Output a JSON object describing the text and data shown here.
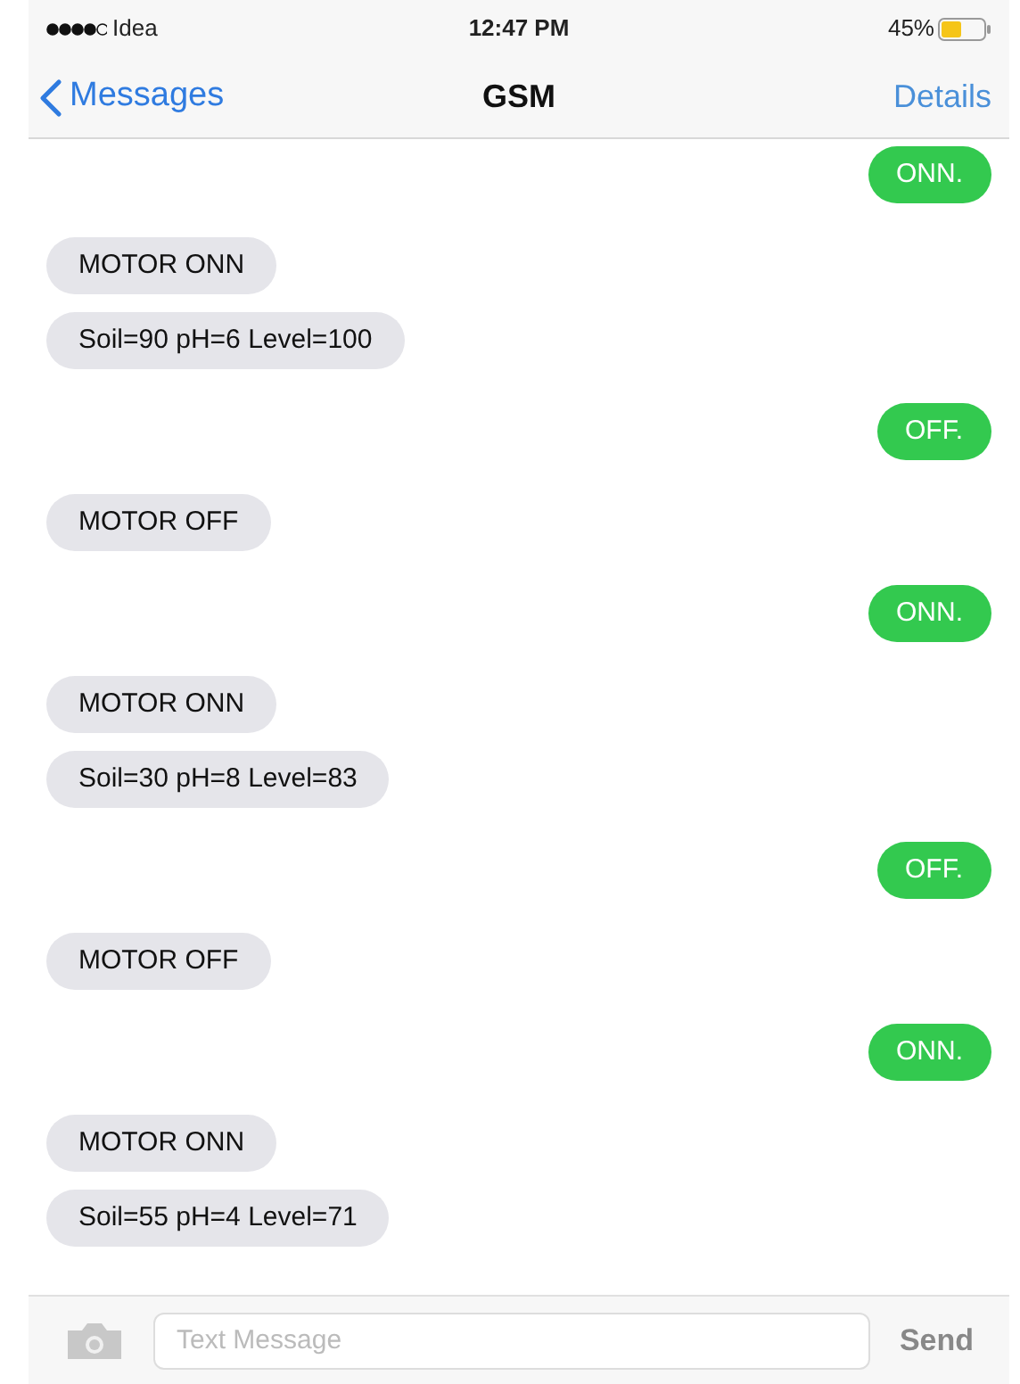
{
  "status_bar": {
    "carrier": "Idea",
    "time": "12:47 PM",
    "battery": "45%"
  },
  "nav": {
    "back": "Messages",
    "title": "GSM",
    "action": "Details"
  },
  "messages": [
    {
      "kind": "sent",
      "text": "ONN."
    },
    {
      "kind": "received",
      "text": "MOTOR ONN"
    },
    {
      "kind": "received",
      "text": "Soil=90 pH=6 Level=100"
    },
    {
      "kind": "sent",
      "text": "OFF."
    },
    {
      "kind": "received",
      "text": "MOTOR OFF"
    },
    {
      "kind": "sent",
      "text": "ONN."
    },
    {
      "kind": "received",
      "text": "MOTOR ONN"
    },
    {
      "kind": "received",
      "text": "Soil=30 pH=8 Level=83"
    },
    {
      "kind": "sent",
      "text": "OFF."
    },
    {
      "kind": "received",
      "text": "MOTOR OFF"
    },
    {
      "kind": "sent",
      "text": "ONN."
    },
    {
      "kind": "received",
      "text": "MOTOR ONN"
    },
    {
      "kind": "received",
      "text": "Soil=55 pH=4 Level=71"
    }
  ],
  "composer": {
    "placeholder": "Text Message",
    "send": "Send"
  }
}
